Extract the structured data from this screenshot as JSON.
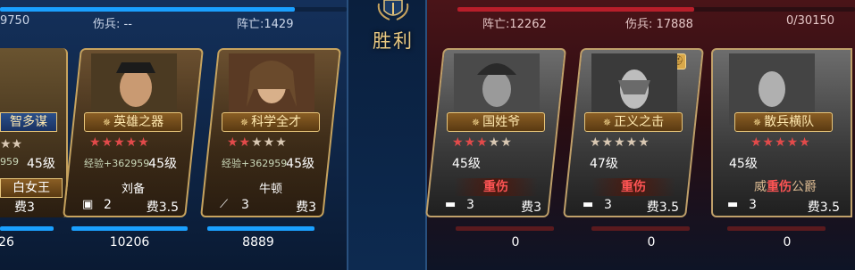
{
  "header": {
    "victory_label": "胜利",
    "left_stats": {
      "kills_partial": "9750",
      "wounded_label": "伤兵: --",
      "dead_label": "阵亡:1429"
    },
    "right_stats": {
      "dead_label": "阵亡:12262",
      "wounded_label": "伤兵: 17888",
      "troops": "0/30150"
    }
  },
  "left_cards": [
    {
      "title": "智多谋",
      "stars_on": 0,
      "stars_total": 5,
      "exp": "959",
      "level": "45级",
      "name": "白女王",
      "cost": "费3",
      "count": "",
      "bottom": "26"
    },
    {
      "title": "英雄之器",
      "stars_on": 5,
      "stars_total": 5,
      "exp": "经验+362959",
      "level": "45级",
      "name": "刘备",
      "count": "2",
      "cost": "费3.5",
      "bottom": "10206",
      "unit_icon": "tank-icon"
    },
    {
      "title": "科学全才",
      "stars_on": 2,
      "stars_total": 5,
      "exp": "经验+362959",
      "level": "45级",
      "name": "牛顿",
      "count": "3",
      "cost": "费3",
      "bottom": "8889",
      "unit_icon": "musket-icon"
    }
  ],
  "right_cards": [
    {
      "title": "国姓爷",
      "stars_on": 3,
      "stars_total": 5,
      "level": "45级",
      "status": "重伤",
      "count": "3",
      "cost": "费3",
      "bottom": "0",
      "unit_icon": "tank-icon"
    },
    {
      "title": "正义之击",
      "stars_on": 0,
      "stars_total": 5,
      "level": "47级",
      "status": "重伤",
      "count": "3",
      "cost": "费3.5",
      "bottom": "0",
      "unit_icon": "tank-icon"
    },
    {
      "title": "散兵横队",
      "stars_on": 5,
      "stars_total": 5,
      "level": "45级",
      "status": "重伤",
      "name_prefix": "威",
      "name_suffix": "公爵",
      "count": "3",
      "cost": "费3.5",
      "bottom": "0",
      "unit_icon": "tank-icon"
    }
  ],
  "colors": {
    "blue_bar": "#1aa0ff",
    "red_bar": "#b81e2a",
    "gold": "#e7c57a",
    "star_red": "#e24a4a"
  }
}
